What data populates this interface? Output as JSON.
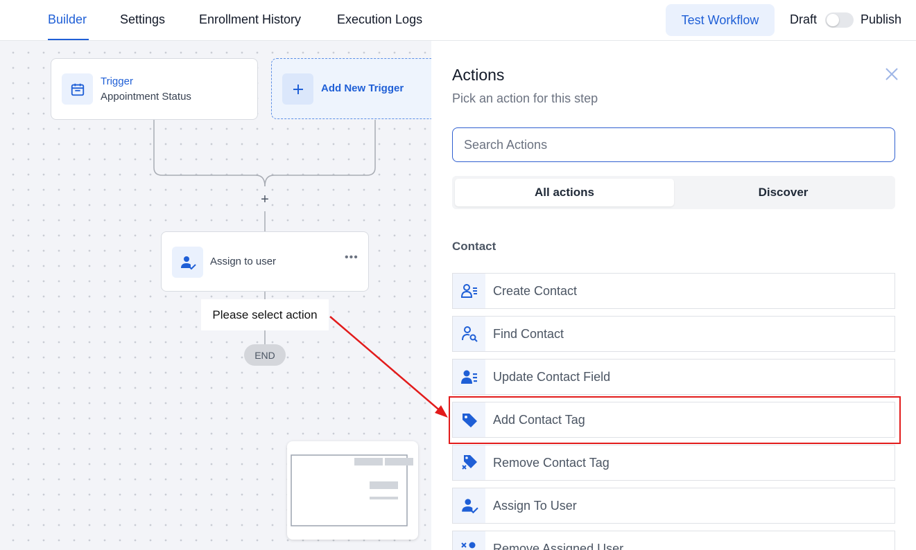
{
  "header": {
    "tabs": [
      {
        "label": "Builder",
        "active": true
      },
      {
        "label": "Settings"
      },
      {
        "label": "Enrollment History"
      },
      {
        "label": "Execution Logs"
      }
    ],
    "test_button": "Test Workflow",
    "draft_label": "Draft",
    "publish_label": "Publish",
    "publish_toggle_on": false
  },
  "canvas": {
    "trigger": {
      "title": "Trigger",
      "subtitle": "Appointment Status",
      "icon": "calendar-icon"
    },
    "add_trigger": {
      "label": "Add New Trigger",
      "icon": "plus-icon"
    },
    "add_step": "+",
    "step": {
      "label": "Assign to user",
      "icon": "user-check-icon",
      "menu": "•••"
    },
    "tooltip": "Please select action",
    "end": "END"
  },
  "panel": {
    "title": "Actions",
    "subtitle": "Pick an action for this step",
    "search_placeholder": "Search Actions",
    "segments": [
      "All actions",
      "Discover"
    ],
    "active_segment": "All actions",
    "section": "Contact",
    "actions": [
      {
        "label": "Create Contact",
        "icon": "contact-list-icon"
      },
      {
        "label": "Find Contact",
        "icon": "contact-search-icon"
      },
      {
        "label": "Update Contact Field",
        "icon": "contact-edit-icon"
      },
      {
        "label": "Add Contact Tag",
        "icon": "tag-icon"
      },
      {
        "label": "Remove Contact Tag",
        "icon": "tag-remove-icon"
      },
      {
        "label": "Assign To User",
        "icon": "user-check-icon"
      },
      {
        "label": "Remove Assigned User",
        "icon": "user-remove-icon"
      }
    ]
  },
  "colors": {
    "accent": "#1f5fd6",
    "annotation": "#e21b1b"
  }
}
